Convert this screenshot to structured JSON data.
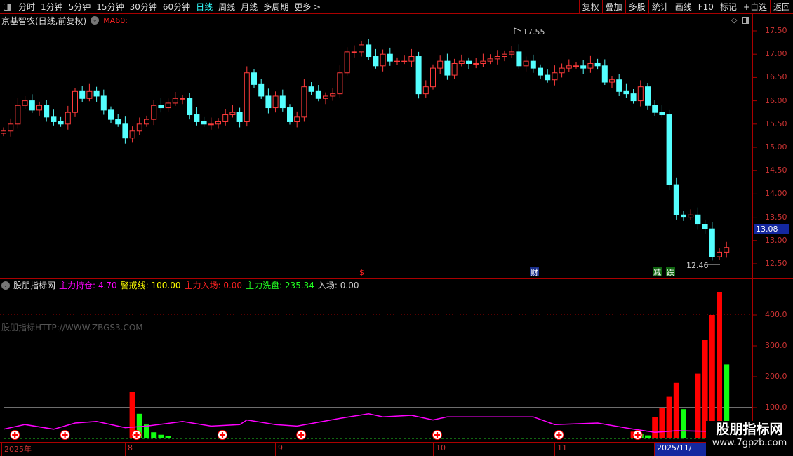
{
  "toolbar": {
    "periods": [
      "分时",
      "1分钟",
      "5分钟",
      "15分钟",
      "30分钟",
      "60分钟",
      "日线",
      "周线",
      "月线",
      "多周期",
      "更多 >"
    ],
    "active": "日线",
    "right_buttons": [
      "复权",
      "叠加",
      "多股",
      "统计",
      "画线",
      "F10",
      "标记",
      "+自选",
      "返回"
    ]
  },
  "stock": {
    "title": "京基智农(日线,前复权)",
    "ma_label": "MA60:"
  },
  "price_axis": [
    "17.50",
    "17.00",
    "16.50",
    "16.00",
    "15.50",
    "15.00",
    "14.50",
    "14.00",
    "13.50",
    "13.00",
    "12.50"
  ],
  "current_price": "13.08",
  "annotations": {
    "high": "17.55",
    "low": "12.46"
  },
  "signals": [
    {
      "text": "$",
      "color": "#f22"
    },
    {
      "text": "财",
      "color": "#fff"
    },
    {
      "text": "减",
      "color": "#fff"
    },
    {
      "text": "跌",
      "color": "#fff"
    }
  ],
  "indicator": {
    "name": "股朋指标网",
    "items": [
      {
        "label": "主力持仓:",
        "value": "4.70",
        "color": "#f0f"
      },
      {
        "label": "警戒线:",
        "value": "100.00",
        "color": "#ff0"
      },
      {
        "label": "主力入场:",
        "value": "0.00",
        "color": "#f22"
      },
      {
        "label": "主力洗盘:",
        "value": "235.34",
        "color": "#2f2"
      },
      {
        "label": "入场:",
        "value": "0.00",
        "color": "#ccc"
      }
    ],
    "watermark": "股朋指标HTTP://WWW.ZBGS3.COM",
    "axis": [
      "400.0",
      "300.0",
      "200.0",
      "100.0"
    ]
  },
  "dates": [
    "2025年",
    "8",
    "9",
    "10",
    "11",
    "2025/11/"
  ],
  "brand": {
    "name": "股朋指标网",
    "url": "www.7gpzb.com"
  },
  "chart_data": {
    "type": "candlestick",
    "ylim": [
      12.3,
      17.75
    ],
    "first_open": 15.3,
    "closes": [
      15.35,
      15.5,
      15.9,
      16.0,
      15.8,
      15.9,
      15.65,
      15.55,
      15.5,
      15.75,
      16.2,
      16.05,
      16.2,
      16.1,
      15.8,
      15.6,
      15.5,
      15.2,
      15.35,
      15.5,
      15.6,
      15.9,
      15.85,
      15.95,
      16.05,
      16.05,
      15.7,
      15.55,
      15.5,
      15.5,
      15.55,
      15.7,
      15.75,
      15.55,
      16.6,
      16.35,
      16.1,
      15.85,
      16.1,
      15.85,
      15.55,
      15.65,
      16.3,
      16.2,
      16.05,
      16.1,
      16.15,
      16.6,
      17.05,
      17.05,
      17.2,
      16.95,
      16.75,
      17.0,
      16.85,
      16.85,
      16.85,
      16.95,
      16.15,
      16.3,
      16.7,
      16.85,
      16.55,
      16.8,
      16.85,
      16.8,
      16.8,
      16.85,
      16.9,
      16.95,
      17.0,
      17.05,
      16.75,
      16.85,
      16.7,
      16.55,
      16.45,
      16.6,
      16.7,
      16.75,
      16.75,
      16.7,
      16.8,
      16.75,
      16.4,
      16.45,
      16.2,
      16.15,
      16.0,
      16.3,
      15.9,
      15.75,
      15.7,
      14.2,
      13.55,
      13.5,
      13.55,
      13.35,
      13.25,
      12.65,
      12.75,
      12.85
    ],
    "indicator_line_keypoints": [
      [
        0,
        30
      ],
      [
        3,
        45
      ],
      [
        7,
        30
      ],
      [
        10,
        50
      ],
      [
        13,
        55
      ],
      [
        17,
        35
      ],
      [
        20,
        40
      ],
      [
        25,
        55
      ],
      [
        29,
        40
      ],
      [
        33,
        45
      ],
      [
        34,
        60
      ],
      [
        38,
        45
      ],
      [
        41,
        40
      ],
      [
        47,
        65
      ],
      [
        51,
        80
      ],
      [
        53,
        70
      ],
      [
        57,
        75
      ],
      [
        60,
        60
      ],
      [
        62,
        70
      ],
      [
        74,
        70
      ],
      [
        77,
        45
      ],
      [
        83,
        50
      ],
      [
        88,
        30
      ],
      [
        91,
        20
      ],
      [
        94,
        25
      ],
      [
        101,
        22
      ]
    ],
    "warning_line": 100,
    "bars": [
      {
        "i": 18,
        "v": 150,
        "c": "red"
      },
      {
        "i": 19,
        "v": 80,
        "c": "green"
      },
      {
        "i": 20,
        "v": 45,
        "c": "green"
      },
      {
        "i": 21,
        "v": 20,
        "c": "green"
      },
      {
        "i": 22,
        "v": 12,
        "c": "green"
      },
      {
        "i": 23,
        "v": 8,
        "c": "green"
      },
      {
        "i": 88,
        "v": 22,
        "c": "red"
      },
      {
        "i": 89,
        "v": 15,
        "c": "green"
      },
      {
        "i": 90,
        "v": 10,
        "c": "green"
      },
      {
        "i": 91,
        "v": 70,
        "c": "red"
      },
      {
        "i": 92,
        "v": 100,
        "c": "red"
      },
      {
        "i": 93,
        "v": 135,
        "c": "red"
      },
      {
        "i": 94,
        "v": 180,
        "c": "red"
      },
      {
        "i": 95,
        "v": 95,
        "c": "green"
      },
      {
        "i": 97,
        "v": 210,
        "c": "red"
      },
      {
        "i": 98,
        "v": 320,
        "c": "red"
      },
      {
        "i": 99,
        "v": 400,
        "c": "red"
      },
      {
        "i": 100,
        "v": 475,
        "c": "red"
      },
      {
        "i": 101,
        "v": 240,
        "c": "green"
      }
    ],
    "markers": [
      1,
      8,
      18,
      30,
      41,
      60,
      77,
      88
    ]
  }
}
